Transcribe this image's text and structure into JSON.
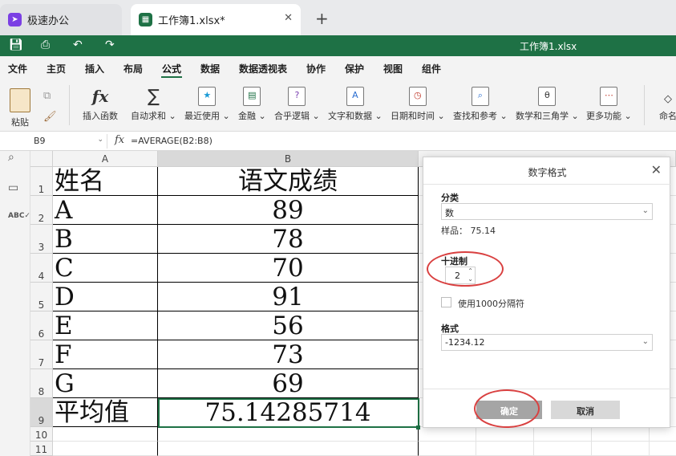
{
  "tabs": [
    {
      "label": "极速办公",
      "icon": "rocket-icon"
    },
    {
      "label": "工作簿1.xlsx*",
      "icon": "spreadsheet-icon"
    }
  ],
  "window": {
    "title": "工作簿1.xlsx"
  },
  "menu": [
    "文件",
    "主页",
    "插入",
    "布局",
    "公式",
    "数据",
    "数据透视表",
    "协作",
    "保护",
    "视图",
    "组件"
  ],
  "active_menu": "公式",
  "ribbon": {
    "paste": "粘贴",
    "buttons": [
      "插入函数",
      "自动求和",
      "最近使用",
      "金融",
      "合乎逻辑",
      "文字和数据",
      "日期和时间",
      "查找和参考",
      "数学和三角学",
      "更多功能",
      "命名"
    ]
  },
  "formula_bar": {
    "name_box": "B9",
    "fx": "fx",
    "formula": "=AVERAGE(B2:B8)"
  },
  "columns": [
    "A",
    "B"
  ],
  "rows": [
    {
      "n": "1",
      "a": "姓名",
      "b": "语文成绩"
    },
    {
      "n": "2",
      "a": "A",
      "b": "89"
    },
    {
      "n": "3",
      "a": "B",
      "b": "78"
    },
    {
      "n": "4",
      "a": "C",
      "b": "70"
    },
    {
      "n": "5",
      "a": "D",
      "b": "91"
    },
    {
      "n": "6",
      "a": "E",
      "b": "56"
    },
    {
      "n": "7",
      "a": "F",
      "b": "73"
    },
    {
      "n": "8",
      "a": "G",
      "b": "69"
    },
    {
      "n": "9",
      "a": "平均值",
      "b": "75.14285714"
    },
    {
      "n": "10",
      "a": "",
      "b": ""
    },
    {
      "n": "11",
      "a": "",
      "b": ""
    }
  ],
  "dialog": {
    "title": "数字格式",
    "category_label": "分类",
    "category_value": "数",
    "sample": "样品： 75.14",
    "decimal_label": "十进制",
    "decimal_value": "2",
    "thousands_label": "使用1000分隔符",
    "format_label": "格式",
    "format_value": "-1234.12",
    "ok": "确定",
    "cancel": "取消"
  },
  "colors": {
    "accent": "#1e7145",
    "annotation": "#d94040"
  }
}
